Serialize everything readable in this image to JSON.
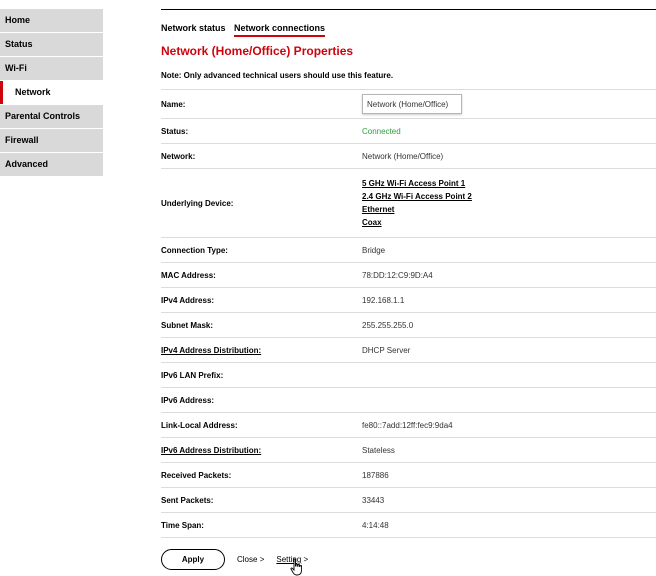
{
  "sidebar": {
    "items": [
      {
        "label": "Home"
      },
      {
        "label": "Status"
      },
      {
        "label": "Wi-Fi"
      },
      {
        "label": "Network"
      },
      {
        "label": "Parental Controls"
      },
      {
        "label": "Firewall"
      },
      {
        "label": "Advanced"
      }
    ]
  },
  "tabs": [
    {
      "label": "Network status"
    },
    {
      "label": "Network connections"
    }
  ],
  "page": {
    "title": "Network (Home/Office) Properties",
    "note": "Note: Only advanced technical users should use this feature."
  },
  "fields": {
    "name": {
      "label": "Name:",
      "value": "Network (Home/Office)"
    },
    "status": {
      "label": "Status:",
      "value": "Connected"
    },
    "network": {
      "label": "Network:",
      "value": "Network (Home/Office)"
    },
    "underlying": {
      "label": "Underlying Device:",
      "devices": [
        "5 GHz Wi-Fi Access Point 1",
        "2.4 GHz Wi-Fi Access Point 2",
        "Ethernet",
        "Coax"
      ]
    },
    "connection_type": {
      "label": "Connection Type:",
      "value": "Bridge"
    },
    "mac": {
      "label": "MAC Address:",
      "value": "78:DD:12:C9:9D:A4"
    },
    "ipv4": {
      "label": "IPv4 Address:",
      "value": "192.168.1.1"
    },
    "subnet": {
      "label": "Subnet Mask:",
      "value": "255.255.255.0"
    },
    "ipv4_dist": {
      "label": "IPv4 Address Distribution:",
      "value": "DHCP Server"
    },
    "ipv6_prefix": {
      "label": "IPv6 LAN Prefix:",
      "value": ""
    },
    "ipv6_addr": {
      "label": "IPv6 Address:",
      "value": ""
    },
    "link_local": {
      "label": "Link-Local Address:",
      "value": "fe80::7add:12ff:fec9:9da4"
    },
    "ipv6_dist": {
      "label": "IPv6 Address Distribution:",
      "value": "Stateless"
    },
    "rx": {
      "label": "Received Packets:",
      "value": "187886"
    },
    "tx": {
      "label": "Sent Packets:",
      "value": "33443"
    },
    "time_span": {
      "label": "Time Span:",
      "value": "4:14:48"
    }
  },
  "footer": {
    "apply": "Apply",
    "close": "Close",
    "setting": "Setting",
    "chevron": ">"
  },
  "colors": {
    "accent": "#cd040b",
    "connected": "#2e9e3e",
    "nav_bg": "#d9d9d9"
  },
  "icons": {
    "cursor": "hand-pointer-icon"
  }
}
